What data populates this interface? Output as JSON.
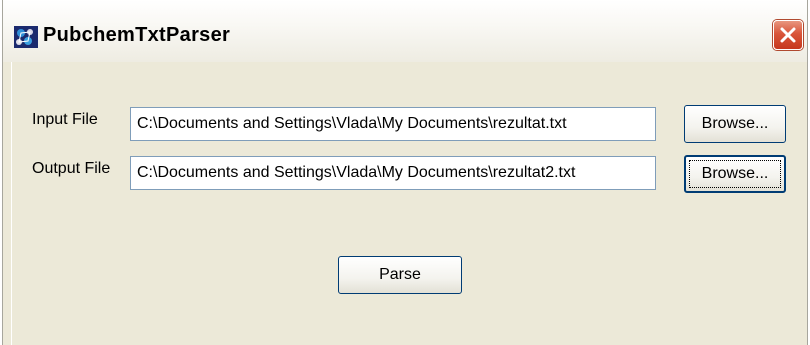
{
  "window": {
    "title": "PubchemTxtParser"
  },
  "form": {
    "input_label": "Input File",
    "input_value": "C:\\Documents and Settings\\Vlada\\My Documents\\rezultat.txt",
    "input_browse_label": "Browse...",
    "output_label": "Output File",
    "output_value": "C:\\Documents and Settings\\Vlada\\My Documents\\rezultat2.txt",
    "output_browse_label": "Browse...",
    "parse_label": "Parse"
  },
  "icons": {
    "app": "app-icon",
    "close": "close-icon"
  },
  "colors": {
    "window_bg": "#ece9d8",
    "close_button": "#d9553a",
    "button_border": "#003c74",
    "textbox_border": "#7f9db9"
  }
}
